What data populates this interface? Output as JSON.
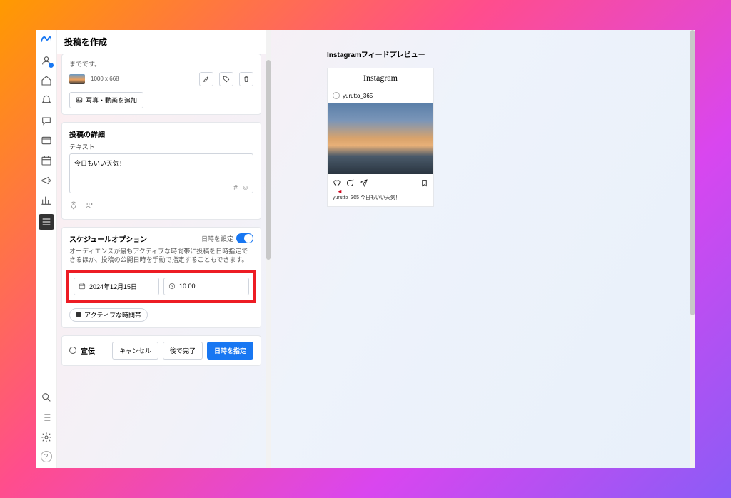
{
  "title": "投稿を作成",
  "media": {
    "cut_text": "までです。",
    "dimensions": "1000 x 668",
    "add_button": "写真・動画を追加"
  },
  "details": {
    "heading": "投稿の詳細",
    "text_label": "テキスト",
    "text_value": "今日もいい天気！"
  },
  "schedule": {
    "heading": "スケジュールオプション",
    "toggle_label": "日時を設定",
    "description": "オーディエンスが最もアクティブな時間帯に投稿を日時指定できるほか、投稿の公開日時を手動で指定することもできます。",
    "date": "2024年12月15日",
    "time": "10:00",
    "active_label": "アクティブな時間帯"
  },
  "footer": {
    "promo": "宣伝",
    "cancel": "キャンセル",
    "later": "後で完了",
    "schedule_btn": "日時を指定"
  },
  "preview": {
    "heading": "Instagramフィードプレビュー",
    "brand": "Instagram",
    "username": "yurutto_365",
    "caption": "yurutto_365 今日もいい天気！"
  }
}
